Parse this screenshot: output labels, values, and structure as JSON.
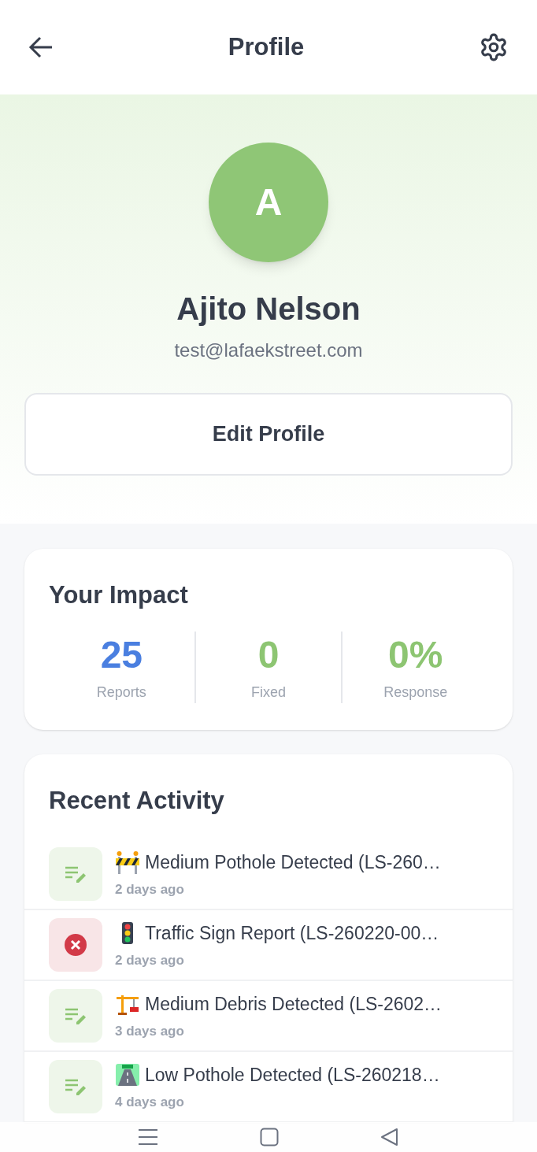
{
  "header": {
    "title": "Profile"
  },
  "profile": {
    "initial": "A",
    "name": "Ajito Nelson",
    "email": "test@lafaekstreet.com",
    "edit_button": "Edit Profile"
  },
  "impact": {
    "title": "Your Impact",
    "stats": [
      {
        "value": "25",
        "label": "Reports",
        "color": "#4a7fe0"
      },
      {
        "value": "0",
        "label": "Fixed",
        "color": "#8dc572"
      },
      {
        "value": "0%",
        "label": "Response",
        "color": "#8dc572"
      }
    ]
  },
  "recent_activity": {
    "title": "Recent Activity",
    "items": [
      {
        "kind": "report",
        "symbol": {
          "kind": "barrier"
        },
        "title": "Medium Pothole Detected (LS-260…",
        "time": "2 days ago"
      },
      {
        "kind": "rejected",
        "symbol": {
          "kind": "traffic-light"
        },
        "title": "Traffic Sign Report (LS-260220-00…",
        "time": "2 days ago"
      },
      {
        "kind": "report",
        "symbol": {
          "kind": "crane"
        },
        "title": "Medium Debris Detected (LS-2602…",
        "time": "3 days ago"
      },
      {
        "kind": "report",
        "symbol": {
          "kind": "road"
        },
        "title": "Low Pothole Detected (LS-260218…",
        "time": "4 days ago"
      }
    ]
  }
}
